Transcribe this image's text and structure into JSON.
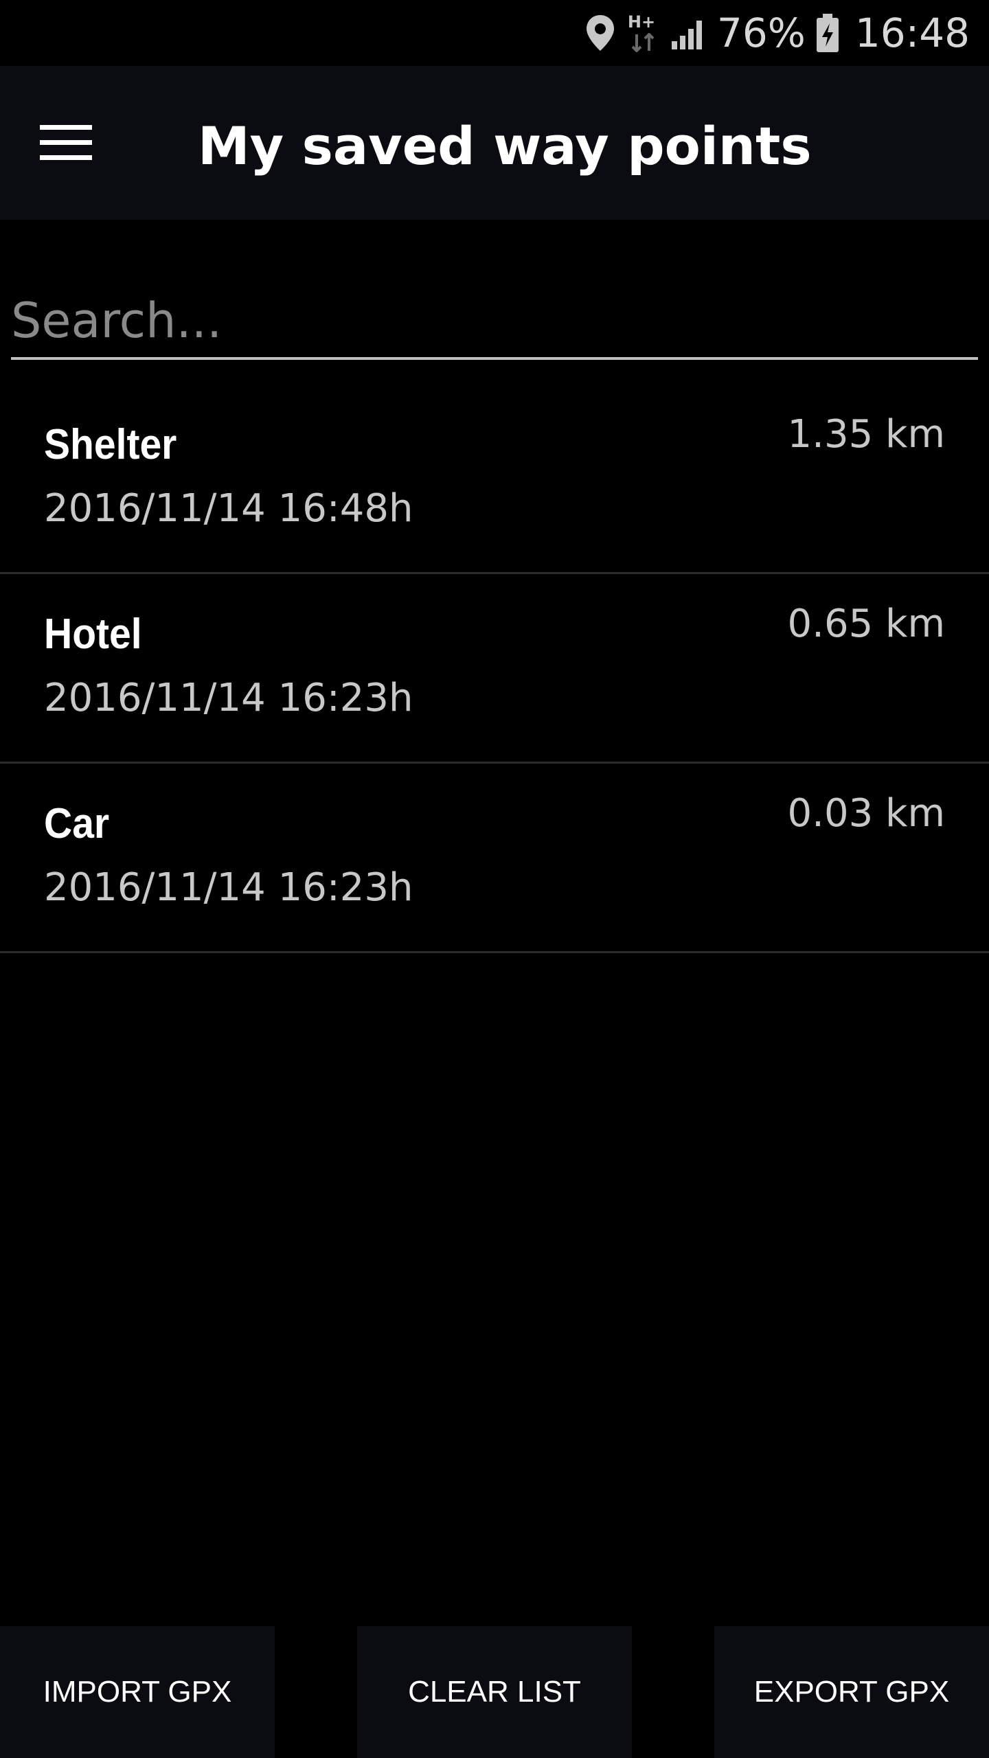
{
  "status_bar": {
    "icons": [
      "location-icon",
      "h-plus-data-icon",
      "signal-icon",
      "battery-charging-icon"
    ],
    "network_label": "H+",
    "battery_percent": "76%",
    "time": "16:48"
  },
  "app_bar": {
    "menu_icon": "hamburger-menu-icon",
    "title": "My saved way points"
  },
  "search": {
    "placeholder": "Search...",
    "value": ""
  },
  "waypoints": [
    {
      "name": "Shelter",
      "date": "2016/11/14 16:48h",
      "distance": "1.35 km"
    },
    {
      "name": "Hotel",
      "date": "2016/11/14 16:23h",
      "distance": "0.65 km"
    },
    {
      "name": "Car",
      "date": "2016/11/14 16:23h",
      "distance": "0.03 km"
    }
  ],
  "bottom_buttons": {
    "import_label": "IMPORT GPX",
    "clear_label": "CLEAR LIST",
    "export_label": "EXPORT GPX"
  }
}
